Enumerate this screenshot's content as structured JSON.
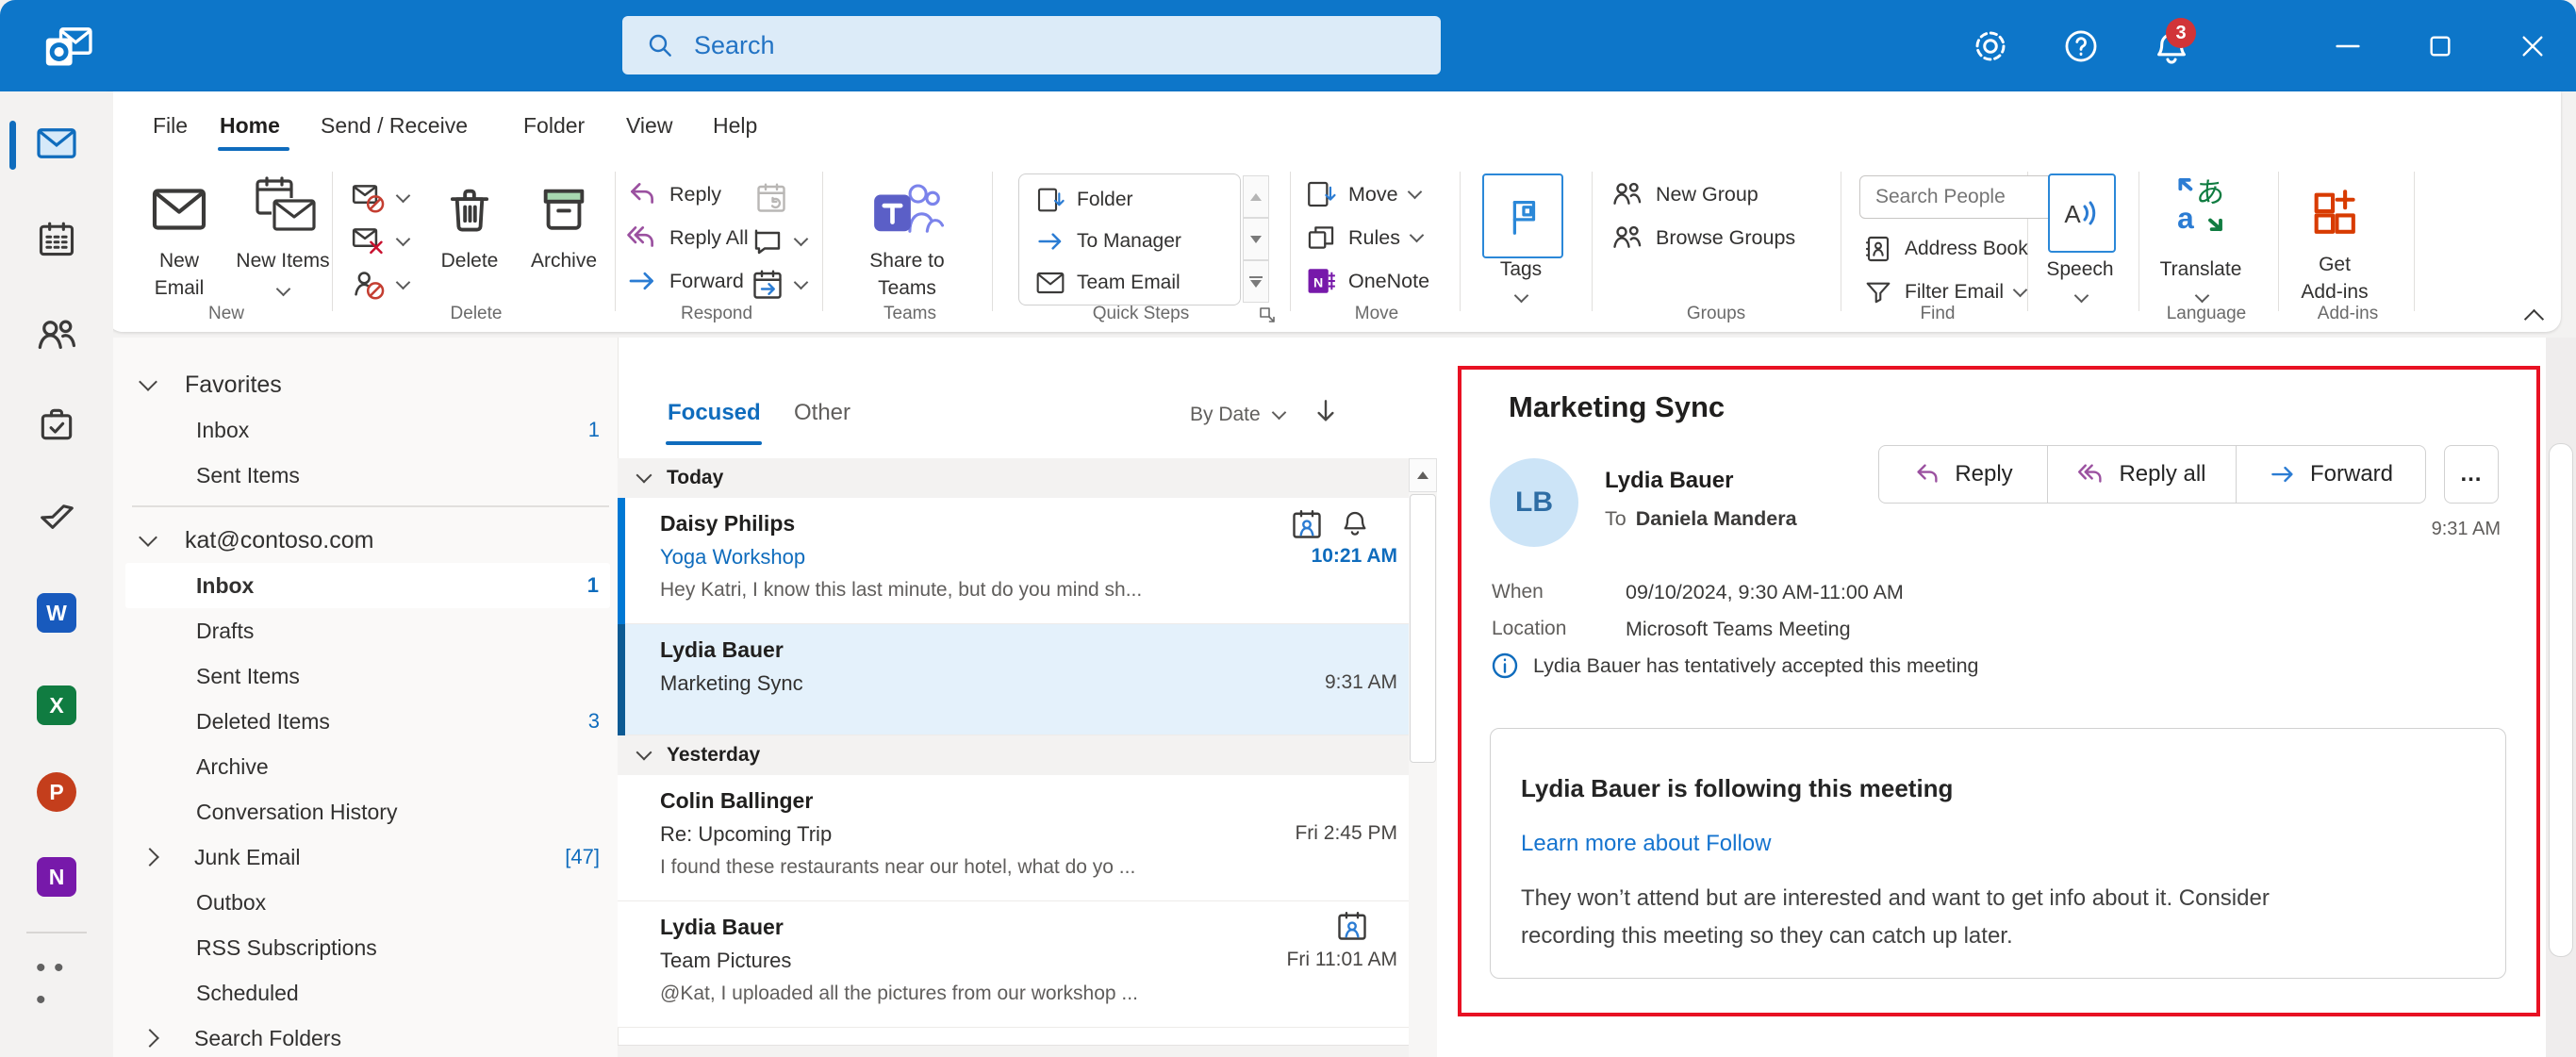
{
  "titlebar": {
    "search_placeholder": "Search",
    "notification_count": "3"
  },
  "menubar": {
    "items": [
      "File",
      "Home",
      "Send / Receive",
      "Folder",
      "View",
      "Help"
    ],
    "active_item": "Home"
  },
  "ribbon": {
    "new": {
      "label": "New",
      "new_email": "New Email",
      "new_items": "New Items"
    },
    "delete": {
      "label": "Delete",
      "delete_btn": "Delete",
      "archive_btn": "Archive"
    },
    "respond": {
      "label": "Respond",
      "reply": "Reply",
      "reply_all": "Reply All",
      "forward": "Forward"
    },
    "teams": {
      "label": "Teams",
      "share_to_teams": "Share to Teams"
    },
    "quick_steps": {
      "label": "Quick Steps",
      "items": [
        "Folder",
        "To Manager",
        "Team Email"
      ]
    },
    "move": {
      "label": "Move",
      "move_btn": "Move",
      "rules": "Rules",
      "onenote": "OneNote"
    },
    "tags": {
      "tags_btn": "Tags"
    },
    "groups": {
      "label": "Groups",
      "new_group": "New Group",
      "browse_groups": "Browse Groups"
    },
    "find": {
      "label": "Find",
      "search_people_placeholder": "Search People",
      "address_book": "Address Book",
      "filter_email": "Filter Email"
    },
    "speech": {
      "speech_btn": "Speech"
    },
    "language": {
      "label": "Language",
      "translate": "Translate"
    },
    "addins": {
      "label": "Add-ins",
      "get_addins": "Get Add-ins"
    }
  },
  "folder_pane": {
    "sections": [
      {
        "header": "Favorites",
        "items": [
          {
            "label": "Inbox",
            "count": "1"
          },
          {
            "label": "Sent Items"
          }
        ]
      },
      {
        "header": "kat@contoso.com",
        "items": [
          {
            "label": "Inbox",
            "count": "1"
          },
          {
            "label": "Drafts"
          },
          {
            "label": "Sent Items"
          },
          {
            "label": "Deleted Items",
            "count": "3"
          },
          {
            "label": "Archive"
          },
          {
            "label": "Conversation History"
          },
          {
            "label": "Junk Email",
            "count": "[47]"
          },
          {
            "label": "Outbox"
          },
          {
            "label": "RSS Subscriptions"
          },
          {
            "label": "Scheduled"
          },
          {
            "label": "Search Folders"
          }
        ]
      }
    ]
  },
  "message_list": {
    "tabs": {
      "focused": "Focused",
      "other": "Other"
    },
    "sort_label": "By Date",
    "groups": [
      {
        "header": "Today",
        "emails": [
          {
            "sender": "Daisy Philips",
            "subject": "Yoga Workshop",
            "preview": "Hey Katri, I know this last minute, but do you mind sh...",
            "time": "10:21 AM"
          },
          {
            "sender": "Lydia Bauer",
            "subject": "Marketing Sync",
            "time": "9:31 AM"
          }
        ]
      },
      {
        "header": "Yesterday",
        "emails": [
          {
            "sender": "Colin Ballinger",
            "subject": "Re: Upcoming Trip",
            "preview": "I found these restaurants near our hotel, what do yo ...",
            "time": "Fri 2:45 PM"
          },
          {
            "sender": "Lydia Bauer",
            "subject": "Team Pictures",
            "preview": "@Kat, I uploaded all the pictures from our workshop ...",
            "time": "Fri 11:01 AM"
          }
        ]
      }
    ]
  },
  "reading_pane": {
    "subject": "Marketing Sync",
    "avatar_initials": "LB",
    "sender": "Lydia Bauer",
    "to_label": "To",
    "recipient": "Daniela Mandera",
    "actions": {
      "reply": "Reply",
      "reply_all": "Reply all",
      "forward": "Forward",
      "more": "…"
    },
    "received_time": "9:31 AM",
    "details": {
      "when_label": "When",
      "when": "09/10/2024, 9:30 AM-11:00 AM",
      "location_label": "Location",
      "location": "Microsoft Teams Meeting"
    },
    "status_note": "Lydia Bauer has tentatively accepted this meeting",
    "follow_card": {
      "title": "Lydia Bauer is following this meeting",
      "link": "Learn more about Follow",
      "body": "They won’t attend but are interested and want to get info about it. Consider recording this meeting so they can catch up later."
    }
  },
  "colors": {
    "titlebar_blue": "#0D76C9",
    "accent_blue": "#0F6CBD",
    "unread_blue": "#0078D4",
    "annotation_red": "#E81123",
    "selected_mail_bg": "#E4F1FB"
  }
}
